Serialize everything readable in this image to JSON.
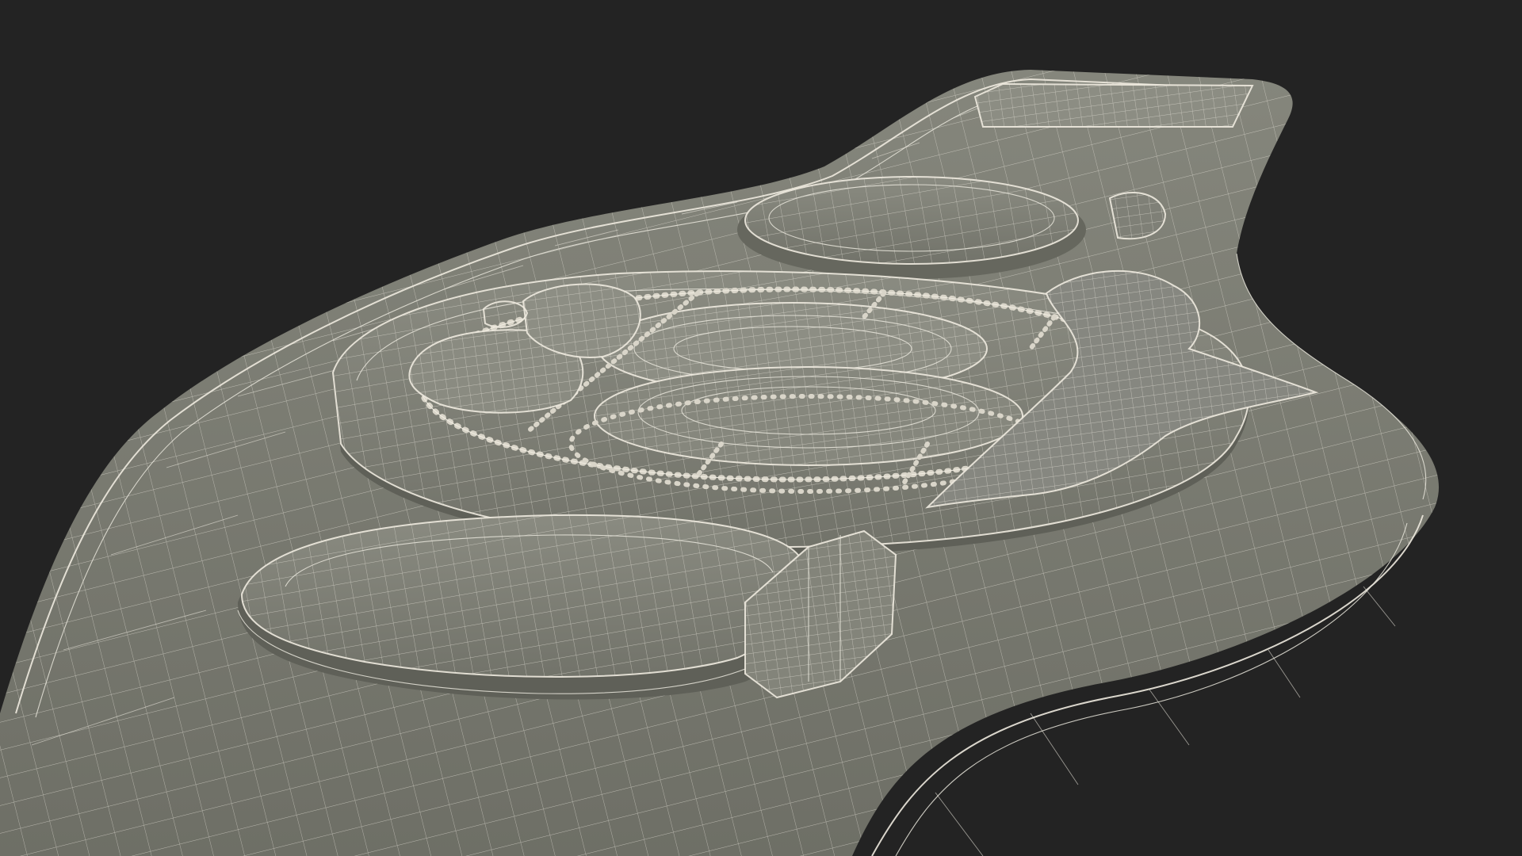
{
  "scene": {
    "background_color": "#232323",
    "surface_color": "#7b7c72",
    "surface_dark_color": "#5f6058",
    "wire_color": "#e9e6dc",
    "render_style": "wireframe-on-shaded",
    "subject_icon": "championship-belt-3d-model"
  }
}
